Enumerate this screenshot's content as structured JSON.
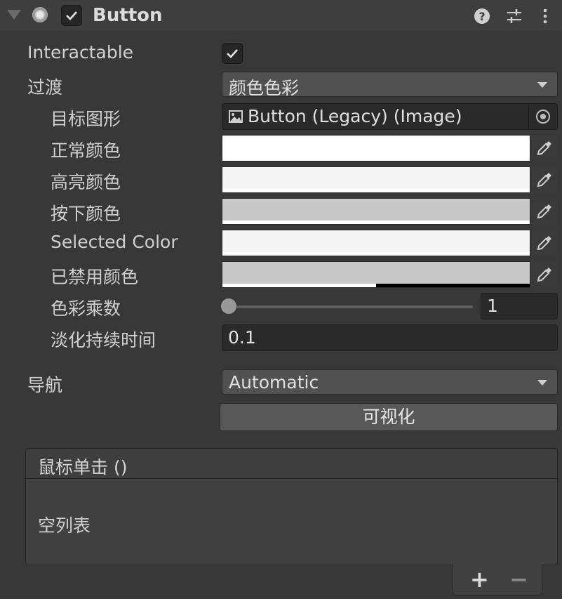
{
  "component": {
    "title": "Button",
    "enabled": true
  },
  "fields": {
    "interactable": {
      "label": "Interactable",
      "checked": true
    },
    "transition": {
      "label": "过渡",
      "value": "颜色色彩"
    },
    "target_graphic": {
      "label": "目标图形",
      "value": "Button (Legacy) (Image)"
    },
    "normal_color": {
      "label": "正常颜色",
      "color": "#ffffff"
    },
    "highlighted_color": {
      "label": "高亮颜色",
      "color": "#f5f5f5"
    },
    "pressed_color": {
      "label": "按下颜色",
      "color": "#c8c8c8"
    },
    "selected_color": {
      "label": "Selected Color",
      "color": "#f5f5f5"
    },
    "disabled_color": {
      "label": "已禁用颜色",
      "color": "#c8c8c8",
      "alpha": 0.5
    },
    "color_multiplier": {
      "label": "色彩乘数",
      "value": "1",
      "slider_fraction": 0
    },
    "fade_duration": {
      "label": "淡化持续时间",
      "value": "0.1"
    },
    "navigation": {
      "label": "导航",
      "value": "Automatic"
    },
    "visualize_button": "可视化"
  },
  "on_click": {
    "header": "鼠标单击 ()",
    "empty_text": "空列表",
    "add": "+",
    "remove": "−"
  },
  "icons": [
    "foldout-arrow-icon",
    "component-icon",
    "help-icon",
    "preset-icon",
    "more-menu-icon",
    "eyedropper-icon",
    "object-picker-icon",
    "image-icon"
  ]
}
